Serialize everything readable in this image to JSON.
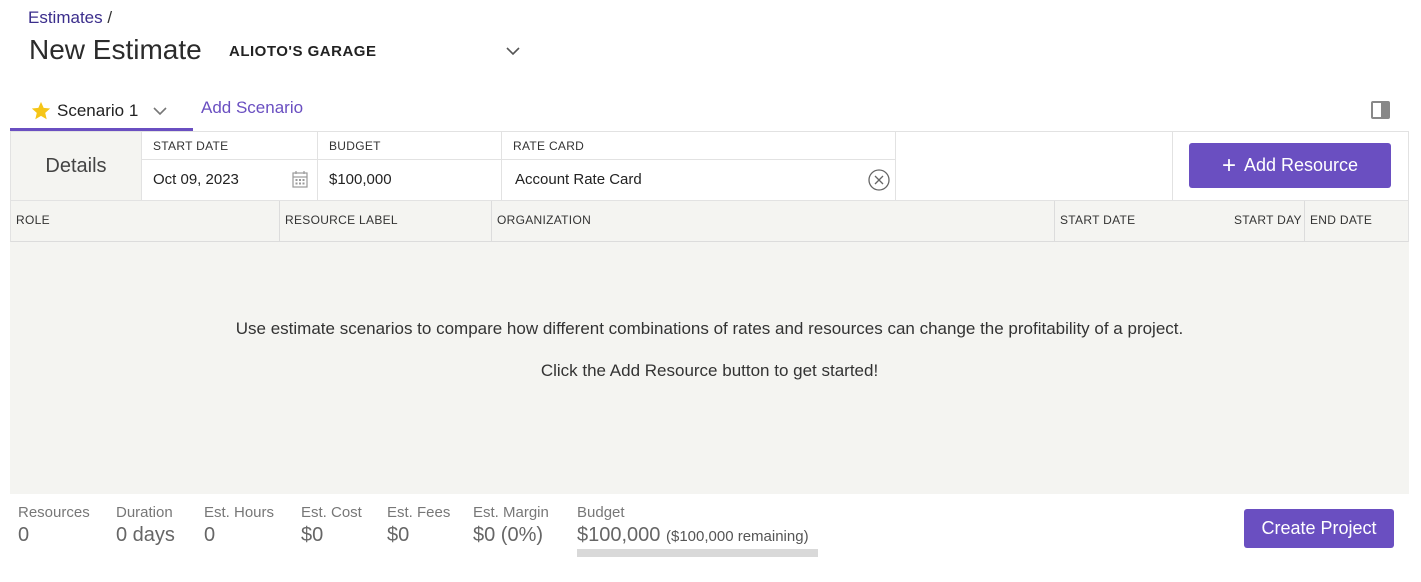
{
  "breadcrumb": {
    "parent": "Estimates",
    "separator": "/"
  },
  "page_title": "New Estimate",
  "client": {
    "name": "ALIOTO'S GARAGE"
  },
  "tabs": {
    "active_label": "Scenario 1",
    "add_label": "Add Scenario"
  },
  "details": {
    "label": "Details",
    "start_date": {
      "label": "START DATE",
      "value": "Oct 09, 2023"
    },
    "budget": {
      "label": "BUDGET",
      "value": "$100,000"
    },
    "rate_card": {
      "label": "RATE CARD",
      "value": "Account Rate Card"
    },
    "add_resource_label": "Add Resource"
  },
  "columns": [
    "ROLE",
    "RESOURCE LABEL",
    "ORGANIZATION",
    "START DATE",
    "START DAY",
    "END DATE"
  ],
  "empty_state": {
    "line1": "Use estimate scenarios to compare how different combinations of rates and resources can change the profitability of a project.",
    "line2": "Click the Add Resource button to get started!"
  },
  "footer": {
    "resources": {
      "label": "Resources",
      "value": "0"
    },
    "duration": {
      "label": "Duration",
      "value": "0 days"
    },
    "hours": {
      "label": "Est. Hours",
      "value": "0"
    },
    "cost": {
      "label": "Est. Cost",
      "value": "$0"
    },
    "fees": {
      "label": "Est. Fees",
      "value": "$0"
    },
    "margin": {
      "label": "Est. Margin",
      "value": "$0 (0%)"
    },
    "budget": {
      "label": "Budget",
      "value": "$100,000",
      "remaining": "($100,000 remaining)",
      "used_fraction": 0
    },
    "create_project_label": "Create Project"
  },
  "colors": {
    "accent": "#6a4fc1",
    "star": "#f5c518",
    "panel_bg": "#f4f4f1"
  }
}
